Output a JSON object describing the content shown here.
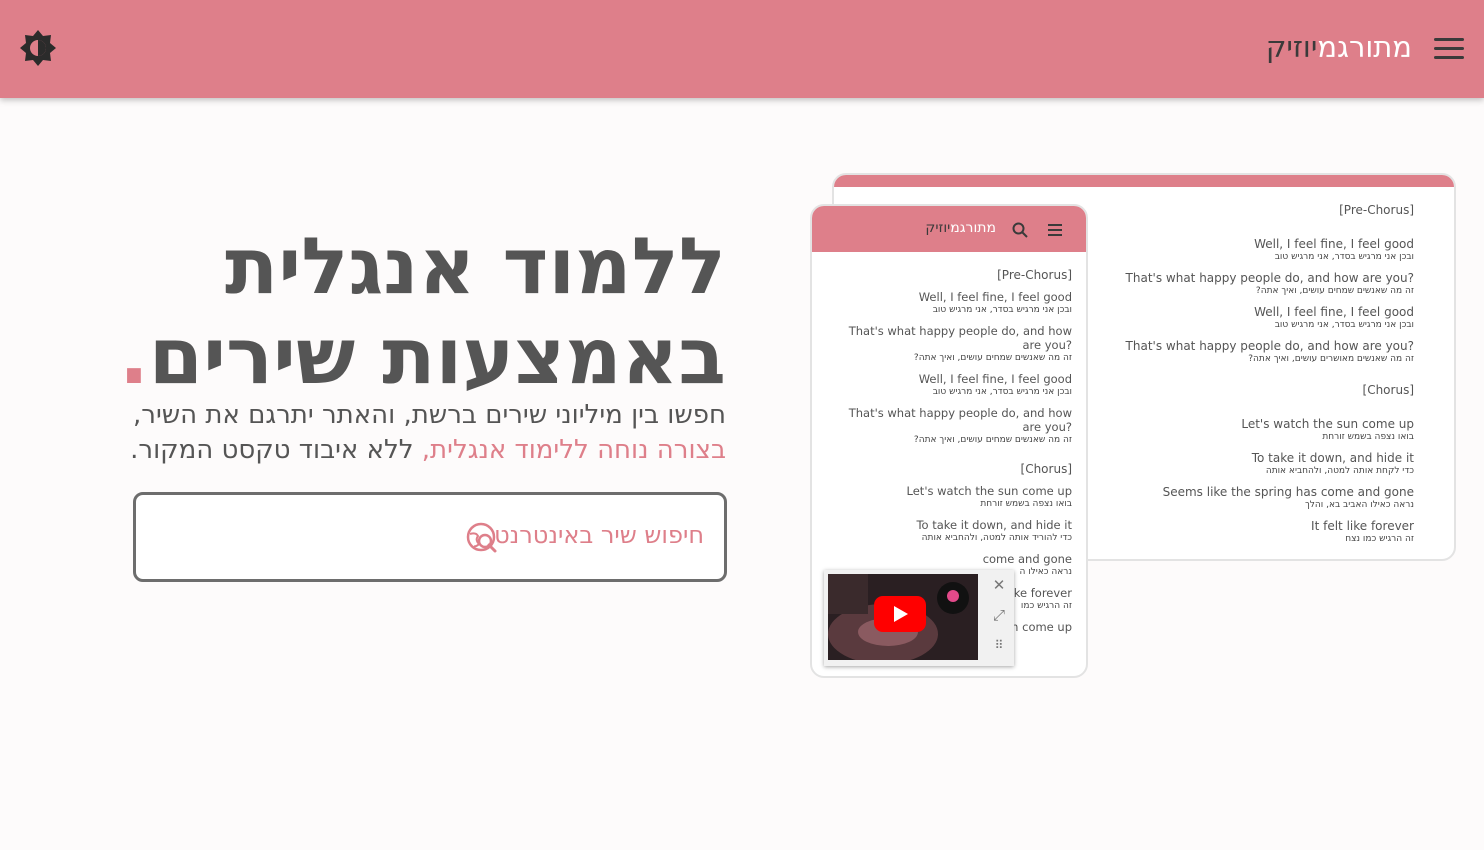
{
  "header": {
    "brand_main": "מתורגמ",
    "brand_accent": "יוזיק"
  },
  "hero": {
    "title_line1": "ללמוד אנגלית",
    "title_line2": "באמצעות שירים",
    "title_dot": ".",
    "subtitle_line1": "חפשו בין מיליוני שירים ברשת, והאתר יתרגם את השיר,",
    "subtitle_pink": "בצורה נוחה ללימוד אנגלית,",
    "subtitle_rest": " ללא איבוד טקסט המקור."
  },
  "search": {
    "label": "חיפוש שיר באינטרנט"
  },
  "desktop_preview": {
    "pre_chorus_label": "[Pre-Chorus]",
    "pre_chorus_lines": [
      {
        "en": "Well, I feel fine, I feel good",
        "he": "ובכן אני מרגיש בסדר, אני מרגיש טוב"
      },
      {
        "en": "That's what happy people do, and how are you?",
        "he": "זה מה שאנשים שמחים עושים, ואיך אתה?"
      },
      {
        "en": "Well, I feel fine, I feel good",
        "he": "ובכן אני מרגיש בסדר, אני מרגיש טוב"
      },
      {
        "en": "That's what happy people do, and how are you?",
        "he": "זה מה שאנשים מאושרים עושים, ואיך אתה?"
      }
    ],
    "chorus_label": "[Chorus]",
    "chorus_lines": [
      {
        "en": "Let's watch the sun come up",
        "he": "בואו נצפה בשמש זורחת"
      },
      {
        "en": "To take it down, and hide it",
        "he": "כדי לקחת אותה למטה, ולהחביא אותה"
      },
      {
        "en": "Seems like the spring has come and gone",
        "he": "נראה כאילו האביב בא, והלך"
      },
      {
        "en": "It felt like forever",
        "he": "זה הרגיש כמו נצח"
      }
    ]
  },
  "mobile_preview": {
    "brand_main": "מתורגמ",
    "brand_accent": "יוזיק",
    "pre_chorus_label": "[Pre-Chorus]",
    "pre_chorus_lines": [
      {
        "en": "Well, I feel fine, I feel good",
        "he": "ובכן אני מרגיש בסדר, אני מרגיש טוב"
      },
      {
        "en": "That's what happy people do, and how are you?",
        "he": "זה מה שאנשים שמחים עושים, ואיך אתה?"
      },
      {
        "en": "Well, I feel fine, I feel good",
        "he": "ובכן אני מרגיש בסדר, אני מרגיש טוב"
      },
      {
        "en": "That's what happy people do, and how are you?",
        "he": "זה מה שאנשים שמחים עושים, ואיך אתה?"
      }
    ],
    "chorus_label": "[Chorus]",
    "chorus_lines": [
      {
        "en": "Let's watch the sun come up",
        "he": "בואו נצפה בשמש זורחת"
      },
      {
        "en": "To take it down, and hide it",
        "he": "כדי להוריד אותה למטה, ולהחביא אותה"
      },
      {
        "en": "come and gone",
        "he": "נראה כאילו ה"
      },
      {
        "en": "like forever",
        "he": "זה הרגיש כמו"
      },
      {
        "en": "n come up",
        "he": ""
      }
    ]
  },
  "video_player": {
    "close_icon": "close-icon",
    "expand_icon": "expand-icon",
    "drag_icon": "drag-handle-icon"
  },
  "colors": {
    "accent": "#de7f8a",
    "text": "#555555",
    "background": "#fdfbfb"
  }
}
